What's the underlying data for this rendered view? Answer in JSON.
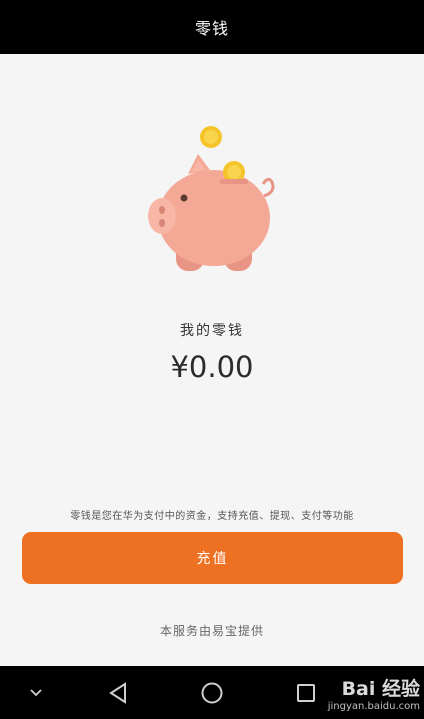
{
  "header": {
    "title": "零钱"
  },
  "wallet": {
    "title": "我的零钱",
    "balance": "¥0.00",
    "description": "零钱是您在华为支付中的资金，支持充值、提现、支付等功能"
  },
  "actions": {
    "recharge_label": "充值"
  },
  "footer": {
    "provider_text": "本服务由易宝提供"
  },
  "navbar": {
    "icons": [
      "chevron-down-icon",
      "back-triangle-icon",
      "home-circle-icon",
      "recents-square-icon"
    ]
  },
  "watermark": {
    "brand": "Bai 经验",
    "url": "jingyan.baidu.com"
  },
  "colors": {
    "accent": "#ee7022",
    "pig": "#f4a896",
    "coin": "#f5c42a",
    "bars": "#000000",
    "background": "#f5f5f5"
  }
}
